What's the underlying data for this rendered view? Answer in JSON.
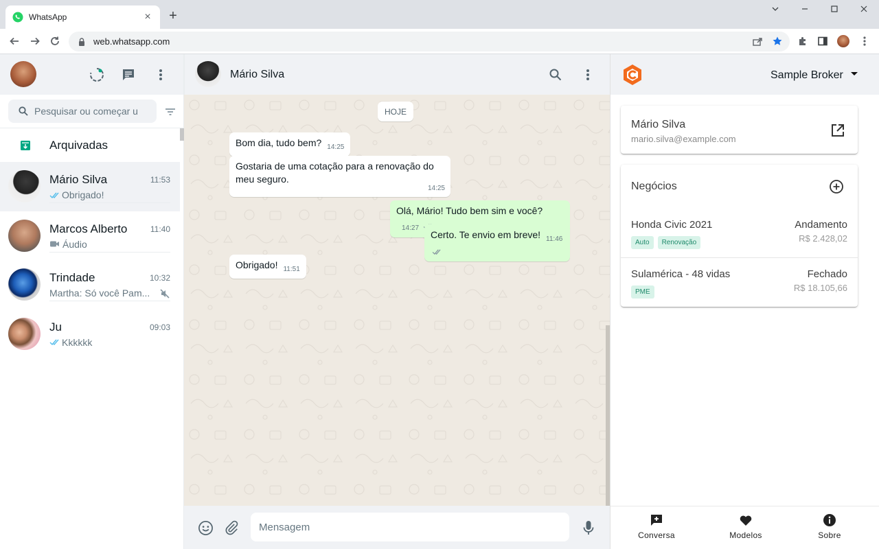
{
  "browser": {
    "tab_title": "WhatsApp",
    "url": "web.whatsapp.com"
  },
  "sidebar": {
    "search_placeholder": "Pesquisar ou começar u...",
    "archived_label": "Arquivadas",
    "chats": [
      {
        "name": "Mário Silva",
        "time": "11:53",
        "preview": "Obrigado!",
        "ticks": "read",
        "active": true
      },
      {
        "name": "Marcos Alberto",
        "time": "11:40",
        "preview": "Áudio",
        "ticks": "none",
        "icon": "video-icon"
      },
      {
        "name": "Trindade",
        "time": "10:32",
        "preview": "Martha: Só você Pam...",
        "ticks": "none",
        "muted": true
      },
      {
        "name": "Ju",
        "time": "09:03",
        "preview": "Kkkkkk",
        "ticks": "read"
      }
    ]
  },
  "conversation": {
    "contact_name": "Mário Silva",
    "date_label": "HOJE",
    "messages": [
      {
        "dir": "in",
        "text": "Bom dia, tudo bem?",
        "time": "14:25"
      },
      {
        "dir": "in",
        "text": "Gostaria de uma cotação para a renovação do meu seguro.",
        "time": "14:25"
      },
      {
        "dir": "out",
        "text": "Olá, Mário! Tudo bem sim e você?",
        "time": "14:27"
      },
      {
        "dir": "out",
        "text": "Certo. Te envio em breve!",
        "time": "11:46"
      },
      {
        "dir": "in",
        "text": "Obrigado!",
        "time": "11:51"
      }
    ],
    "input_placeholder": "Mensagem"
  },
  "panel": {
    "broker": "Sample Broker",
    "contact": {
      "name": "Mário Silva",
      "email": "mario.silva@example.com"
    },
    "deals_title": "Negócios",
    "deals": [
      {
        "name": "Honda Civic 2021",
        "status": "Andamento",
        "amount": "R$ 2.428,02",
        "tags": [
          "Auto",
          "Renovação"
        ]
      },
      {
        "name": "Sulamérica - 48 vidas",
        "status": "Fechado",
        "amount": "R$ 18.105,66",
        "tags": [
          "PME"
        ]
      }
    ],
    "nav": [
      {
        "label": "Conversa",
        "icon": "chat-plus-icon"
      },
      {
        "label": "Modelos",
        "icon": "heart-icon"
      },
      {
        "label": "Sobre",
        "icon": "info-icon"
      }
    ]
  },
  "colors": {
    "accent_green": "#00a884",
    "outgoing_bubble": "#d9fdd3",
    "chat_bg": "#efeae2",
    "logo_orange": "#f26b1d"
  }
}
